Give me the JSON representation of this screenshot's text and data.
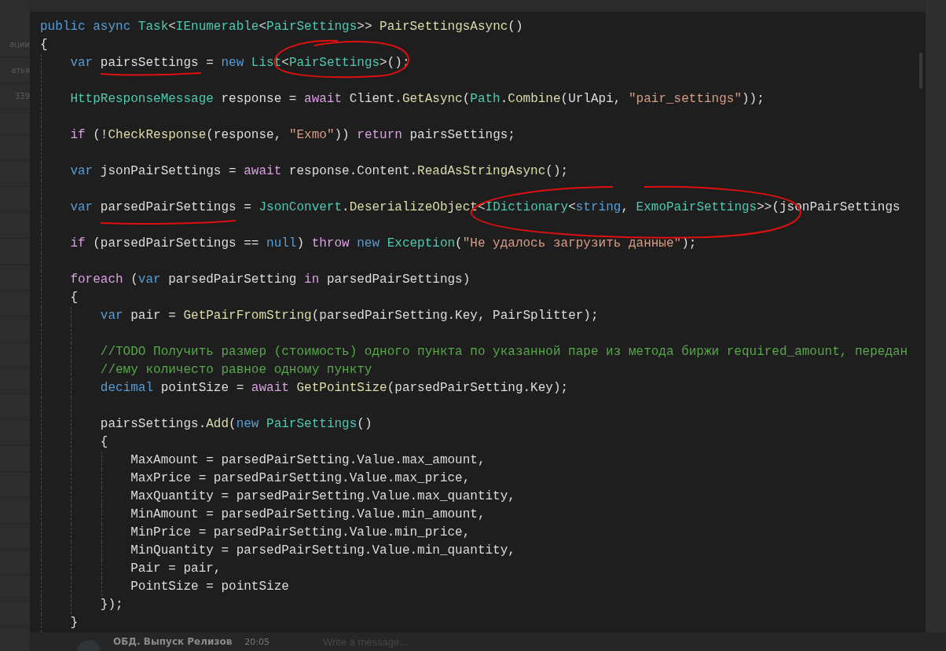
{
  "chat_list": {
    "items": [
      {
        "label": "ации"
      },
      {
        "label": "атья"
      },
      {
        "label": "339"
      }
    ]
  },
  "code_editor": {
    "lines": [
      {
        "kind": "code",
        "tokens": [
          {
            "kind": "keyword",
            "text": "public "
          },
          {
            "kind": "keyword",
            "text": "async "
          },
          {
            "kind": "type",
            "text": "Task"
          },
          {
            "kind": "plain",
            "text": "<"
          },
          {
            "kind": "type",
            "text": "IEnumerable"
          },
          {
            "kind": "plain",
            "text": "<"
          },
          {
            "kind": "type",
            "text": "PairSettings"
          },
          {
            "kind": "plain",
            "text": ">> "
          },
          {
            "kind": "method",
            "text": "PairSettingsAsync"
          },
          {
            "kind": "plain",
            "text": "()"
          }
        ]
      },
      {
        "kind": "code",
        "tokens": [
          {
            "kind": "plain",
            "text": "{"
          }
        ]
      },
      {
        "kind": "code",
        "tokens": [
          {
            "kind": "keyword",
            "text": "    var"
          },
          {
            "kind": "plain",
            "text": " pairsSettings = "
          },
          {
            "kind": "keyword",
            "text": "new "
          },
          {
            "kind": "type",
            "text": "List"
          },
          {
            "kind": "plain",
            "text": "<"
          },
          {
            "kind": "type",
            "text": "PairSettings"
          },
          {
            "kind": "plain",
            "text": ">();"
          }
        ]
      },
      {
        "kind": "blank"
      },
      {
        "kind": "code",
        "tokens": [
          {
            "kind": "type",
            "text": "    HttpResponseMessage"
          },
          {
            "kind": "plain",
            "text": " response = "
          },
          {
            "kind": "control",
            "text": "await"
          },
          {
            "kind": "plain",
            "text": " Client."
          },
          {
            "kind": "method",
            "text": "GetAsync"
          },
          {
            "kind": "plain",
            "text": "("
          },
          {
            "kind": "type",
            "text": "Path"
          },
          {
            "kind": "plain",
            "text": "."
          },
          {
            "kind": "method",
            "text": "Combine"
          },
          {
            "kind": "plain",
            "text": "(UrlApi, "
          },
          {
            "kind": "string",
            "text": "\"pair_settings\""
          },
          {
            "kind": "plain",
            "text": "));"
          }
        ]
      },
      {
        "kind": "blank"
      },
      {
        "kind": "code",
        "tokens": [
          {
            "kind": "control",
            "text": "    if"
          },
          {
            "kind": "plain",
            "text": " (!"
          },
          {
            "kind": "method",
            "text": "CheckResponse"
          },
          {
            "kind": "plain",
            "text": "(response, "
          },
          {
            "kind": "string",
            "text": "\"Exmo\""
          },
          {
            "kind": "plain",
            "text": ")) "
          },
          {
            "kind": "control",
            "text": "return"
          },
          {
            "kind": "plain",
            "text": " pairsSettings;"
          }
        ]
      },
      {
        "kind": "blank"
      },
      {
        "kind": "code",
        "tokens": [
          {
            "kind": "keyword",
            "text": "    var"
          },
          {
            "kind": "plain",
            "text": " jsonPairSettings = "
          },
          {
            "kind": "control",
            "text": "await"
          },
          {
            "kind": "plain",
            "text": " response.Content."
          },
          {
            "kind": "method",
            "text": "ReadAsStringAsync"
          },
          {
            "kind": "plain",
            "text": "();"
          }
        ]
      },
      {
        "kind": "blank"
      },
      {
        "kind": "code",
        "tokens": [
          {
            "kind": "keyword",
            "text": "    var"
          },
          {
            "kind": "plain",
            "text": " parsedPairSettings = "
          },
          {
            "kind": "type",
            "text": "JsonConvert"
          },
          {
            "kind": "plain",
            "text": "."
          },
          {
            "kind": "method",
            "text": "DeserializeObject"
          },
          {
            "kind": "plain",
            "text": "<"
          },
          {
            "kind": "type",
            "text": "IDictionary"
          },
          {
            "kind": "plain",
            "text": "<"
          },
          {
            "kind": "keyword",
            "text": "string"
          },
          {
            "kind": "plain",
            "text": ", "
          },
          {
            "kind": "type",
            "text": "ExmoPairSettings"
          },
          {
            "kind": "plain",
            "text": ">>(jsonPairSettings"
          }
        ]
      },
      {
        "kind": "blank"
      },
      {
        "kind": "code",
        "tokens": [
          {
            "kind": "control",
            "text": "    if"
          },
          {
            "kind": "plain",
            "text": " (parsedPairSettings == "
          },
          {
            "kind": "keyword",
            "text": "null"
          },
          {
            "kind": "plain",
            "text": ") "
          },
          {
            "kind": "control",
            "text": "throw "
          },
          {
            "kind": "keyword",
            "text": "new "
          },
          {
            "kind": "type",
            "text": "Exception"
          },
          {
            "kind": "plain",
            "text": "("
          },
          {
            "kind": "string",
            "text": "\"Не удалось загрузить данные\""
          },
          {
            "kind": "plain",
            "text": ");"
          }
        ]
      },
      {
        "kind": "blank"
      },
      {
        "kind": "code",
        "tokens": [
          {
            "kind": "control",
            "text": "    foreach"
          },
          {
            "kind": "plain",
            "text": " ("
          },
          {
            "kind": "keyword",
            "text": "var"
          },
          {
            "kind": "plain",
            "text": " parsedPairSetting "
          },
          {
            "kind": "control",
            "text": "in"
          },
          {
            "kind": "plain",
            "text": " parsedPairSettings)"
          }
        ]
      },
      {
        "kind": "code",
        "tokens": [
          {
            "kind": "plain",
            "text": "    {"
          }
        ]
      },
      {
        "kind": "code",
        "tokens": [
          {
            "kind": "keyword",
            "text": "        var"
          },
          {
            "kind": "plain",
            "text": " pair = "
          },
          {
            "kind": "method",
            "text": "GetPairFromString"
          },
          {
            "kind": "plain",
            "text": "(parsedPairSetting.Key, PairSplitter);"
          }
        ]
      },
      {
        "kind": "blank"
      },
      {
        "kind": "code",
        "tokens": [
          {
            "kind": "comment",
            "text": "        //TODO Получить размер (стоимость) одного пункта по указанной паре из метода биржи required_amount, передан"
          }
        ]
      },
      {
        "kind": "code",
        "tokens": [
          {
            "kind": "comment",
            "text": "        //ему количесто равное одному пункту"
          }
        ]
      },
      {
        "kind": "code",
        "tokens": [
          {
            "kind": "keyword",
            "text": "        decimal"
          },
          {
            "kind": "plain",
            "text": " pointSize = "
          },
          {
            "kind": "control",
            "text": "await "
          },
          {
            "kind": "method",
            "text": "GetPointSize"
          },
          {
            "kind": "plain",
            "text": "(parsedPairSetting.Key);"
          }
        ]
      },
      {
        "kind": "blank"
      },
      {
        "kind": "code",
        "tokens": [
          {
            "kind": "plain",
            "text": "        pairsSettings."
          },
          {
            "kind": "method",
            "text": "Add"
          },
          {
            "kind": "plain",
            "text": "("
          },
          {
            "kind": "keyword",
            "text": "new "
          },
          {
            "kind": "type",
            "text": "PairSettings"
          },
          {
            "kind": "plain",
            "text": "()"
          }
        ]
      },
      {
        "kind": "code",
        "tokens": [
          {
            "kind": "plain",
            "text": "        {"
          }
        ]
      },
      {
        "kind": "code",
        "tokens": [
          {
            "kind": "plain",
            "text": "            MaxAmount = parsedPairSetting.Value.max_amount,"
          }
        ]
      },
      {
        "kind": "code",
        "tokens": [
          {
            "kind": "plain",
            "text": "            MaxPrice = parsedPairSetting.Value.max_price,"
          }
        ]
      },
      {
        "kind": "code",
        "tokens": [
          {
            "kind": "plain",
            "text": "            MaxQuantity = parsedPairSetting.Value.max_quantity,"
          }
        ]
      },
      {
        "kind": "code",
        "tokens": [
          {
            "kind": "plain",
            "text": "            MinAmount = parsedPairSetting.Value.min_amount,"
          }
        ]
      },
      {
        "kind": "code",
        "tokens": [
          {
            "kind": "plain",
            "text": "            MinPrice = parsedPairSetting.Value.min_price,"
          }
        ]
      },
      {
        "kind": "code",
        "tokens": [
          {
            "kind": "plain",
            "text": "            MinQuantity = parsedPairSetting.Value.min_quantity,"
          }
        ]
      },
      {
        "kind": "code",
        "tokens": [
          {
            "kind": "plain",
            "text": "            Pair = pair,"
          }
        ]
      },
      {
        "kind": "code",
        "tokens": [
          {
            "kind": "plain",
            "text": "            PointSize = pointSize"
          }
        ]
      },
      {
        "kind": "code",
        "tokens": [
          {
            "kind": "plain",
            "text": "        });"
          }
        ]
      },
      {
        "kind": "code",
        "tokens": [
          {
            "kind": "plain",
            "text": "    }"
          }
        ]
      }
    ]
  },
  "message_bar": {
    "placeholder": "Write a message..."
  },
  "last_message": {
    "author": "ОБД. Выпуск Релизов",
    "time": "20:05"
  }
}
